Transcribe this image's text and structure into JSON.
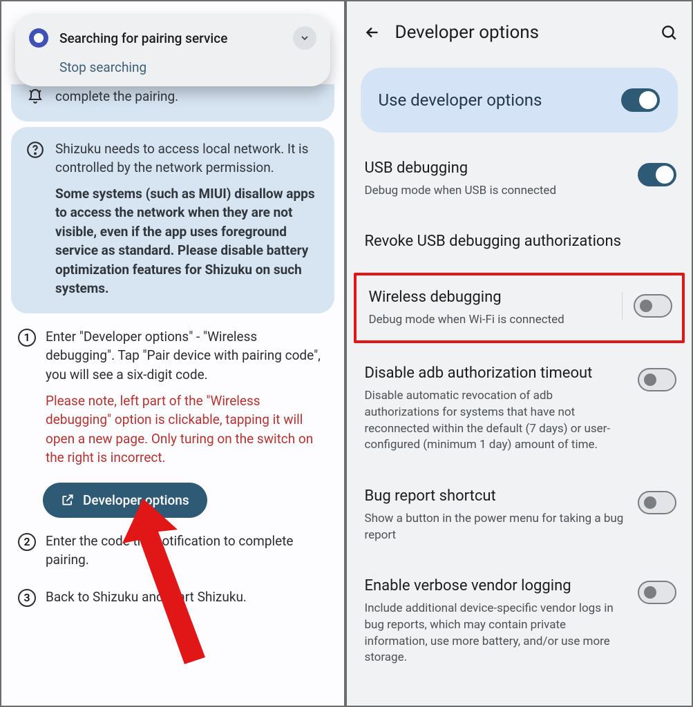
{
  "left": {
    "notification": {
      "title": "Searching for pairing service",
      "action": "Stop searching"
    },
    "peek_text": "complete the pairing.",
    "help_card": {
      "p1": "Shizuku needs to access local network. It is controlled by the network permission.",
      "p2": "Some systems (such as MIUI) disallow apps to access the network when they are not visible, even if the app uses foreground service as standard. Please disable battery optimization features for Shizuku on such systems."
    },
    "steps": {
      "s1": {
        "num": "1",
        "text": "Enter \"Developer options\" - \"Wireless debugging\". Tap \"Pair device with pairing code\", you will see a six-digit code.",
        "warn": "Please note, left part of the \"Wireless debugging\" option is clickable, tapping it will open a new page. Only turing on the switch on the right is incorrect."
      },
      "s2": {
        "num": "2",
        "text": "Enter the code the notification to complete pairing."
      },
      "s3": {
        "num": "3",
        "text": "Back to Shizuku and start Shizuku."
      }
    },
    "dev_button": "Developer options"
  },
  "right": {
    "title": "Developer options",
    "hero": "Use developer options",
    "items": {
      "usb": {
        "title": "USB debugging",
        "sub": "Debug mode when USB is connected"
      },
      "revoke": {
        "title": "Revoke USB debugging authorizations"
      },
      "wireless": {
        "title": "Wireless debugging",
        "sub": "Debug mode when Wi-Fi is connected"
      },
      "adbto": {
        "title": "Disable adb authorization timeout",
        "sub": "Disable automatic revocation of adb authorizations for systems that have not reconnected within the default (7 days) or user-configured (minimum 1 day) amount of time."
      },
      "bug": {
        "title": "Bug report shortcut",
        "sub": "Show a button in the power menu for taking a bug report"
      },
      "verbose": {
        "title": "Enable verbose vendor logging",
        "sub": "Include additional device-specific vendor logs in bug reports, which may contain private information, use more battery, and/or use more storage."
      }
    }
  }
}
